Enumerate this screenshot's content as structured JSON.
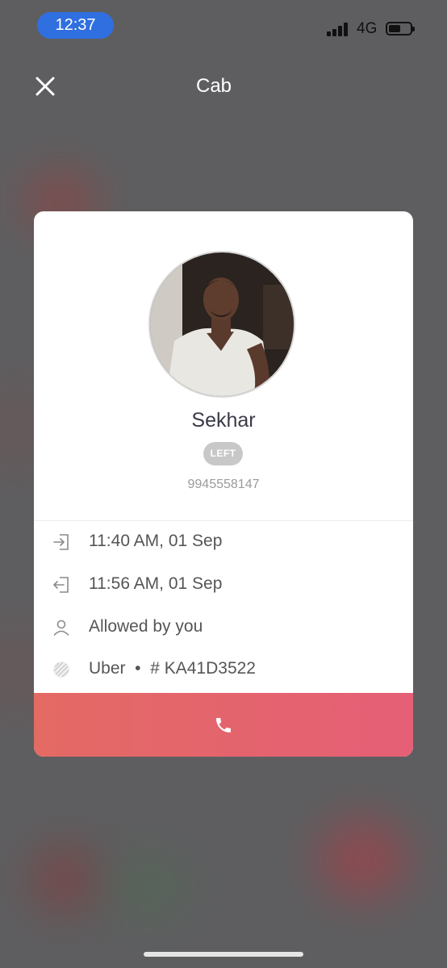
{
  "status_bar": {
    "time": "12:37",
    "network": "4G"
  },
  "header": {
    "title": "Cab"
  },
  "visitor": {
    "name": "Sekhar",
    "status_badge": "LEFT",
    "phone": "9945558147"
  },
  "details": [
    {
      "icon": "entry-icon",
      "text": "11:40 AM, 01 Sep"
    },
    {
      "icon": "exit-icon",
      "text": "11:56 AM, 01 Sep"
    },
    {
      "icon": "person-icon",
      "text": "Allowed by you"
    },
    {
      "icon": "company-logo-icon",
      "text": "Uber  •  # KA41D3522"
    }
  ],
  "colors": {
    "accent_call": "#e5636e",
    "time_pill": "#2f6fe0",
    "badge": "#c8c8c8"
  }
}
